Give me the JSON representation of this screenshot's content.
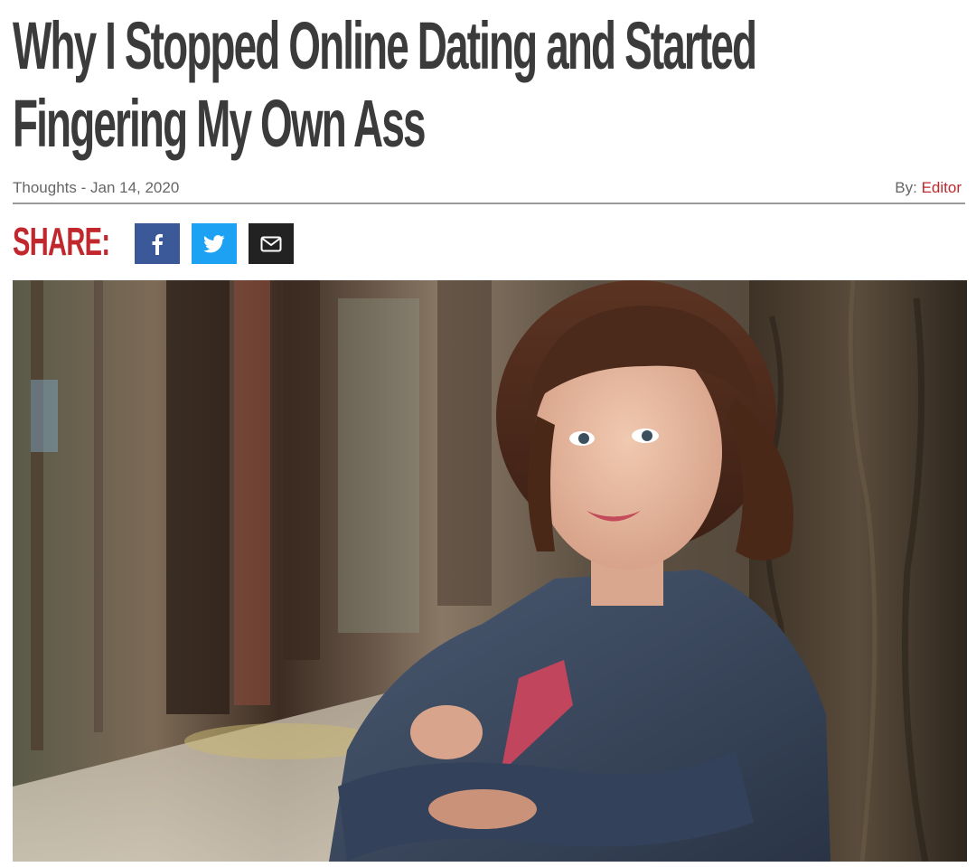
{
  "article": {
    "headline_line1": "Why I Stopped Online Dating and Started",
    "headline_line2": "Fingering My Own Ass",
    "category_date": "Thoughts - Jan 14, 2020",
    "byline_prefix": "By:",
    "byline_author": "Editor"
  },
  "share": {
    "label": "SHARE:",
    "buttons": [
      {
        "name": "facebook",
        "icon": "facebook-icon",
        "color": "#3b5998"
      },
      {
        "name": "twitter",
        "icon": "twitter-icon",
        "color": "#1da1f2"
      },
      {
        "name": "email",
        "icon": "email-icon",
        "color": "#222222"
      }
    ]
  },
  "hero_image": {
    "subject": "woman with short brown bob hair in denim jacket, arms crossed, leaning against tree trunk on a city sidewalk"
  },
  "colors": {
    "headline": "#3b3b3b",
    "accent_red": "#c0282d",
    "meta_gray": "#666666"
  }
}
